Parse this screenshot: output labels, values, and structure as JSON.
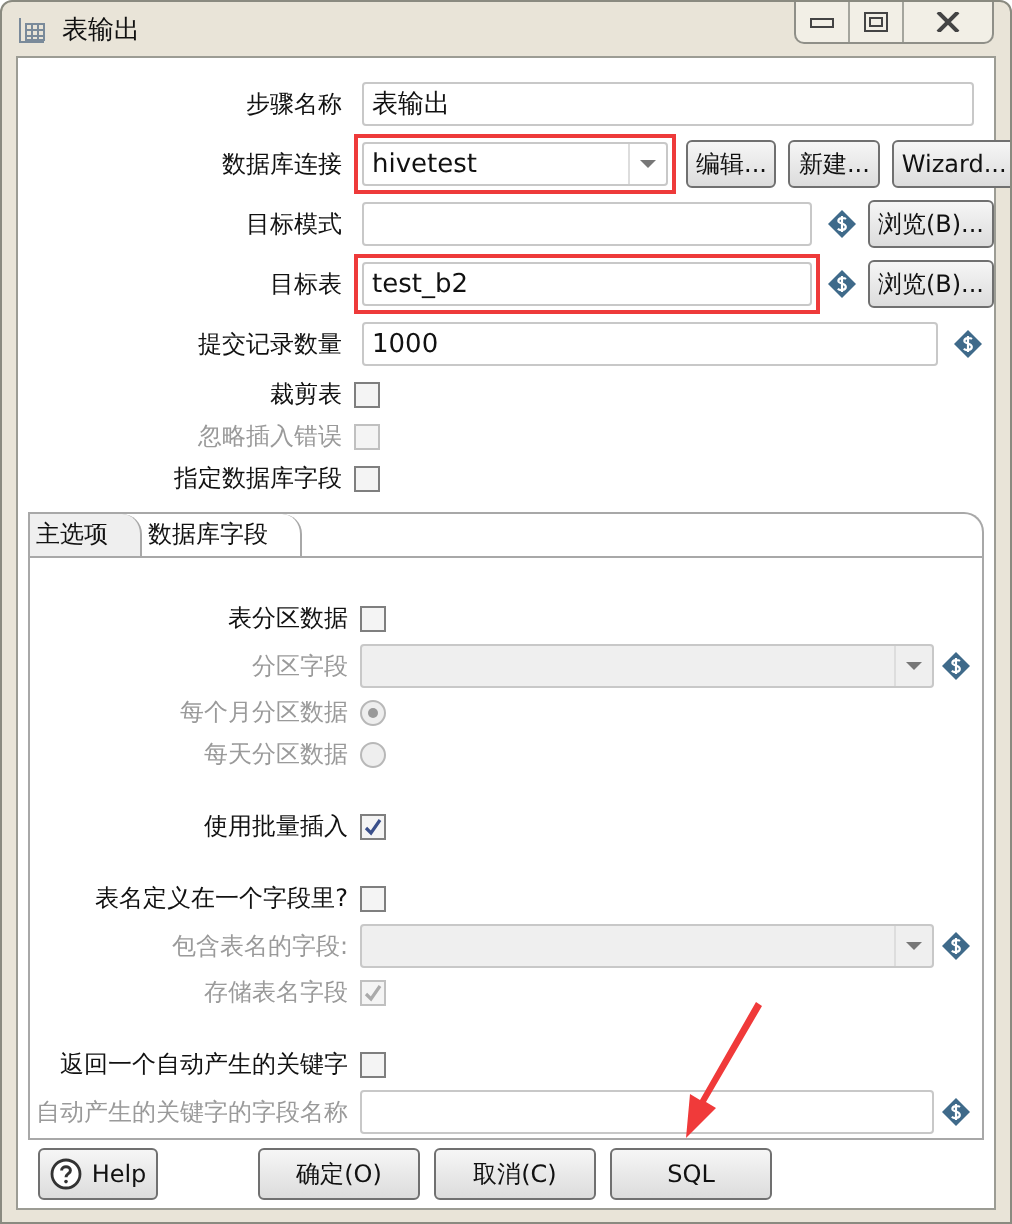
{
  "window": {
    "title": "表输出"
  },
  "fields": [
    {
      "kind": "text",
      "label": "步骤名称",
      "value": "表输出",
      "variable": false,
      "highlighted": false
    },
    {
      "kind": "combo",
      "label": "数据库连接",
      "value": "hivetest",
      "highlighted": true,
      "buttons": [
        "编辑...",
        "新建...",
        "Wizard..."
      ]
    },
    {
      "kind": "text",
      "label": "目标模式",
      "variable": true,
      "highlighted": false,
      "buttons": [
        "浏览(B)..."
      ]
    },
    {
      "kind": "text",
      "label": "目标表",
      "value": "test_b2",
      "variable": true,
      "highlighted": true,
      "buttons": [
        "浏览(B)..."
      ]
    },
    {
      "kind": "text",
      "label": "提交记录数量",
      "value": "1000",
      "variable": true,
      "highlighted": false
    },
    {
      "kind": "checkbox",
      "label": "裁剪表",
      "checked": false,
      "disabled": false
    },
    {
      "kind": "checkbox",
      "label": "忽略插入错误",
      "checked": false,
      "disabled": true
    },
    {
      "kind": "checkbox",
      "label": "指定数据库字段",
      "checked": false,
      "disabled": false
    }
  ],
  "tabs": [
    {
      "label": "主选项",
      "selected": true
    },
    {
      "label": "数据库字段",
      "selected": false
    }
  ],
  "tab_groups": [
    [
      {
        "kind": "checkbox",
        "label": "表分区数据",
        "checked": false,
        "disabled": false
      },
      {
        "kind": "combo",
        "label": "分区字段",
        "disabled": true,
        "variable": true
      },
      {
        "kind": "radio",
        "label": "每个月分区数据",
        "selected": true,
        "disabled": true
      },
      {
        "kind": "radio",
        "label": "每天分区数据",
        "selected": false,
        "disabled": true
      }
    ],
    [
      {
        "kind": "checkbox",
        "label": "使用批量插入",
        "checked": true,
        "disabled": false
      }
    ],
    [
      {
        "kind": "checkbox",
        "label": "表名定义在一个字段里?",
        "checked": false,
        "disabled": false
      },
      {
        "kind": "combo",
        "label": "包含表名的字段:",
        "disabled": true,
        "variable": true
      },
      {
        "kind": "checkbox",
        "label": "存储表名字段",
        "checked": true,
        "disabled": true
      }
    ],
    [
      {
        "kind": "checkbox",
        "label": "返回一个自动产生的关键字",
        "checked": false,
        "disabled": false
      },
      {
        "kind": "text",
        "label": "自动产生的关键字的字段名称",
        "disabled": true,
        "variable": true
      }
    ]
  ],
  "buttons": [
    {
      "kind": "help",
      "label": "Help"
    },
    {
      "kind": "plain",
      "label": "确定(O)"
    },
    {
      "kind": "plain",
      "label": "取消(C)"
    },
    {
      "kind": "plain",
      "label": "SQL"
    }
  ],
  "annotations": [
    {
      "kind": "arrow"
    }
  ]
}
